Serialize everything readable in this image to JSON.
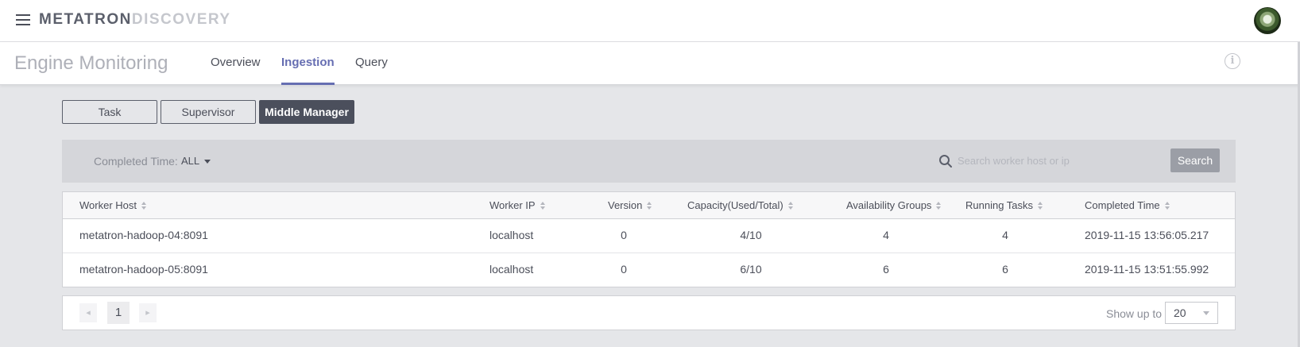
{
  "header": {
    "brand_part1": "METATRON",
    "brand_part2": "DISCOVERY"
  },
  "page": {
    "title": "Engine Monitoring",
    "tabs": [
      {
        "label": "Overview",
        "active": false
      },
      {
        "label": "Ingestion",
        "active": true
      },
      {
        "label": "Query",
        "active": false
      }
    ]
  },
  "segments": [
    {
      "label": "Task",
      "active": false
    },
    {
      "label": "Supervisor",
      "active": false
    },
    {
      "label": "Middle Manager",
      "active": true
    }
  ],
  "filter": {
    "label": "Completed Time:",
    "value": "ALL",
    "search_placeholder": "Search worker host or ip",
    "search_button": "Search"
  },
  "table": {
    "columns": [
      "Worker Host",
      "Worker IP",
      "Version",
      "Capacity(Used/Total)",
      "Availability Groups",
      "Running Tasks",
      "Completed Time"
    ],
    "rows": [
      [
        "metatron-hadoop-04:8091",
        "localhost",
        "0",
        "4/10",
        "4",
        "4",
        "2019-11-15 13:56:05.217"
      ],
      [
        "metatron-hadoop-05:8091",
        "localhost",
        "0",
        "6/10",
        "6",
        "6",
        "2019-11-15 13:51:55.992"
      ]
    ]
  },
  "pagination": {
    "current_page": "1",
    "show_label": "Show up to",
    "page_size": "20"
  },
  "colors": {
    "accent": "#666eb2",
    "active_button": "#4b4f5c"
  }
}
